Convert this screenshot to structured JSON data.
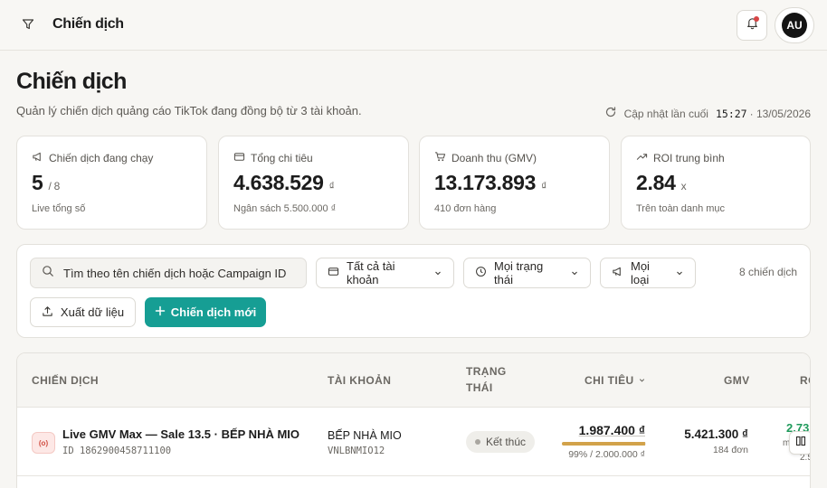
{
  "topbar": {
    "title": "Chiến dịch",
    "avatar_initials": "AU"
  },
  "header": {
    "title": "Chiến dịch",
    "subtitle": "Quản lý chiến dịch quảng cáo TikTok đang đồng bộ từ 3 tài khoản.",
    "sync_label": "Cập nhật lần cuối",
    "sync_time": "15:27",
    "sync_date": "· 13/05/2026"
  },
  "stats": [
    {
      "label": "Chiến dịch đang chạy",
      "value": "5",
      "unit": "/ 8",
      "note": "Live tổng số",
      "icon": "megaphone-icon"
    },
    {
      "label": "Tổng chi tiêu",
      "value": "4.638.529",
      "unit": "₫",
      "note": "Ngân sách 5.500.000 ₫",
      "icon": "wallet-icon"
    },
    {
      "label": "Doanh thu (GMV)",
      "value": "13.173.893",
      "unit": "₫",
      "note": "410 đơn hàng",
      "icon": "cart-icon"
    },
    {
      "label": "ROI trung bình",
      "value": "2.84",
      "unit": "x",
      "note": "Trên toàn danh mục",
      "icon": "trend-up-icon"
    }
  ],
  "filters": {
    "search_placeholder": "Tìm theo tên chiến dịch hoặc Campaign ID",
    "account_select": "Tất cả tài khoản",
    "status_select": "Mọi trạng thái",
    "type_select": "Mọi loại",
    "count": "8 chiến dịch",
    "export_label": "Xuất dữ liệu",
    "new_label": "Chiến dịch mới"
  },
  "table": {
    "columns": {
      "campaign": "CHIẾN DỊCH",
      "account": "TÀI KHOẢN",
      "status_line1": "TRẠNG",
      "status_line2": "THÁI",
      "spend": "CHI TIÊU",
      "gmv": "GMV",
      "roi": "RO"
    },
    "rows": [
      {
        "live_badge": "(o)",
        "name": "Live GMV Max — Sale 13.5 · BẾP NHÀ MIO",
        "id": "ID 1862900458711100",
        "account_name": "BẾP NHÀ MIO",
        "account_code": "VNLBNMIO12",
        "status": "Kết thúc",
        "spend": "1.987.400 ₫",
        "spend_pct": 0.99,
        "spend_meta": "99% / 2.000.000 ₫",
        "gmv": "5.421.300 ₫",
        "orders": "184 đơn",
        "roi": "2.73",
        "roi_sub": "m",
        "roi_sub2": "2.5"
      }
    ]
  },
  "colors": {
    "accent": "#169e94",
    "progress": "#d2a24a",
    "roi_positive": "#1f9a5b",
    "notification": "#d64545"
  }
}
